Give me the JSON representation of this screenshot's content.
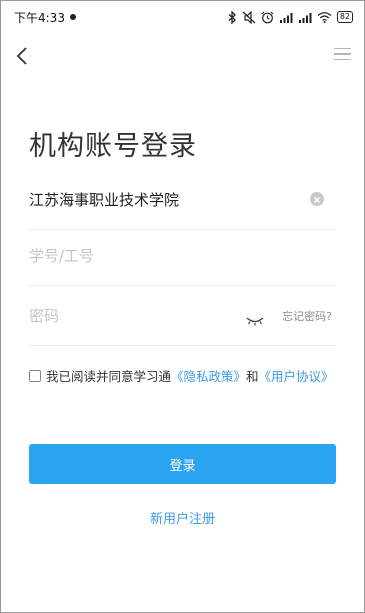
{
  "status_bar": {
    "time": "下午4:33",
    "battery": "82",
    "icons": [
      "bluetooth-icon",
      "mute-icon",
      "alarm-icon",
      "signal-hd-icon",
      "signal-hd-icon",
      "wifi-icon",
      "battery-icon"
    ]
  },
  "nav": {
    "back_icon": "chevron-left-icon",
    "menu_icon": "hamburger-menu-icon"
  },
  "title": "机构账号登录",
  "form": {
    "institution_value": "江苏海事职业技术学院",
    "id_placeholder": "学号/工号",
    "password_placeholder": "密码",
    "forgot_password": "忘记密码?"
  },
  "agreement": {
    "prefix": "我已阅读并同意学习通",
    "privacy_policy": "《隐私政策》",
    "and": "和",
    "user_agreement": "《用户协议》"
  },
  "login_button": "登录",
  "register_link": "新用户注册",
  "colors": {
    "accent": "#2aa4ee",
    "link": "#3b9be6"
  }
}
